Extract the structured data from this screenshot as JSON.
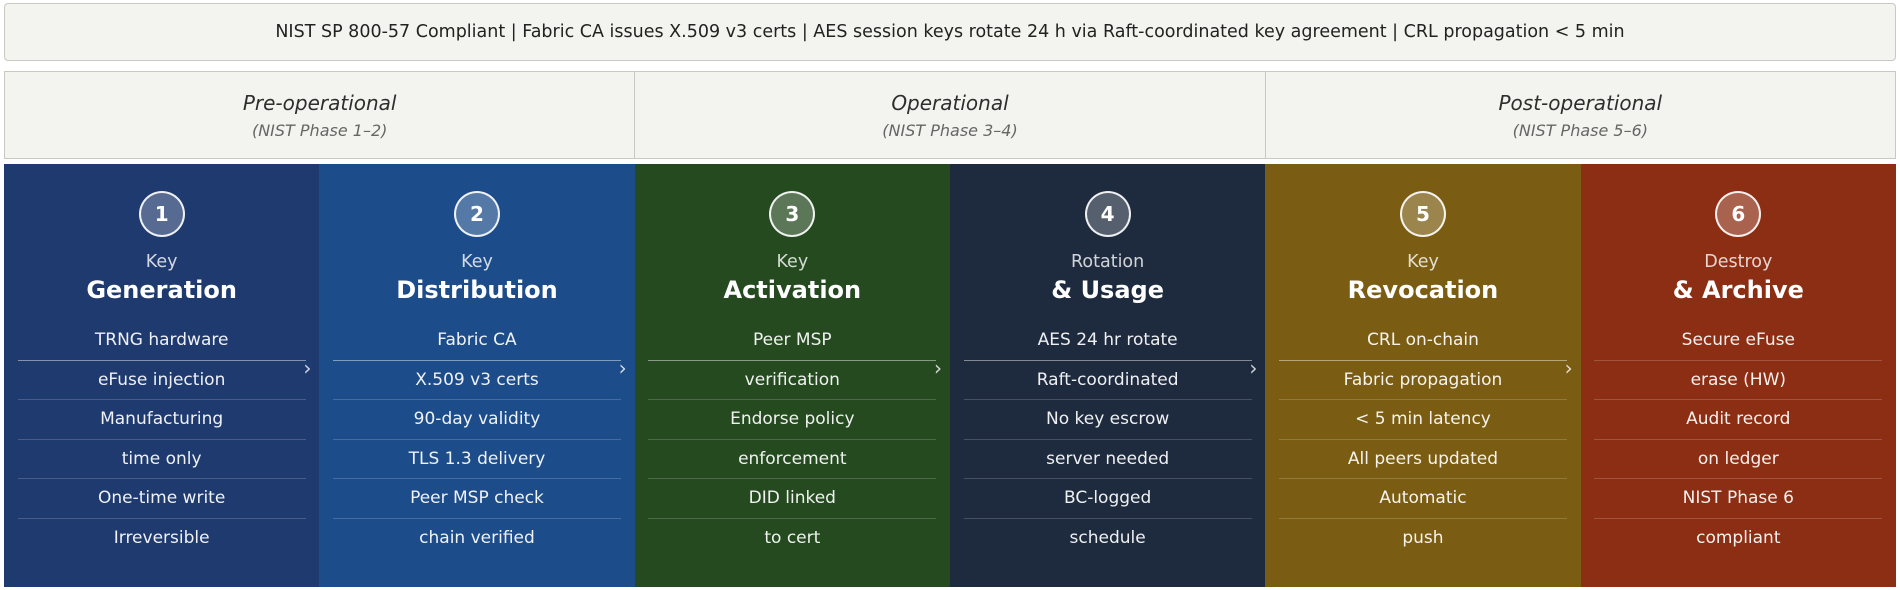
{
  "banner": {
    "text": "NIST SP 800-57 Compliant  |  Fabric CA issues X.509 v3 certs  |  AES session keys rotate 24 h via Raft-coordinated key agreement  |  CRL propagation < 5 min"
  },
  "phases": [
    {
      "title": "Pre-operational",
      "subtitle": "(NIST Phase 1–2)"
    },
    {
      "title": "Operational",
      "subtitle": "(NIST Phase 3–4)"
    },
    {
      "title": "Post-operational",
      "subtitle": "(NIST Phase 5–6)"
    }
  ],
  "stages": [
    {
      "number": "1",
      "prefix": "Key",
      "title": "Generation",
      "color": "#1f3a6e",
      "items": [
        "TRNG hardware",
        "eFuse injection",
        "Manufacturing",
        "time only",
        "One-time write",
        "Irreversible"
      ]
    },
    {
      "number": "2",
      "prefix": "Key",
      "title": "Distribution",
      "color": "#1d4c8a",
      "items": [
        "Fabric CA",
        "X.509 v3 certs",
        "90-day validity",
        "TLS 1.3 delivery",
        "Peer MSP check",
        "chain verified"
      ]
    },
    {
      "number": "3",
      "prefix": "Key",
      "title": "Activation",
      "color": "#254a20",
      "items": [
        "Peer MSP",
        "verification",
        "Endorse policy",
        "enforcement",
        "DID linked",
        "to cert"
      ]
    },
    {
      "number": "4",
      "prefix": "Rotation",
      "title": "& Usage",
      "color": "#1e2a3e",
      "items": [
        "AES 24 hr rotate",
        "Raft-coordinated",
        "No key escrow",
        "server needed",
        "BC-logged",
        "schedule"
      ]
    },
    {
      "number": "5",
      "prefix": "Key",
      "title": "Revocation",
      "color": "#7a5d12",
      "items": [
        "CRL on-chain",
        "Fabric propagation",
        "< 5 min latency",
        "All peers updated",
        "Automatic",
        "push"
      ]
    },
    {
      "number": "6",
      "prefix": "Destroy",
      "title": "& Archive",
      "color": "#8b2e13",
      "items": [
        "Secure eFuse",
        "erase (HW)",
        "Audit record",
        "on ledger",
        "NIST Phase 6",
        "compliant"
      ]
    }
  ],
  "icons": {
    "arrow": "chevron-right-icon",
    "arrow_glyph": "›"
  }
}
